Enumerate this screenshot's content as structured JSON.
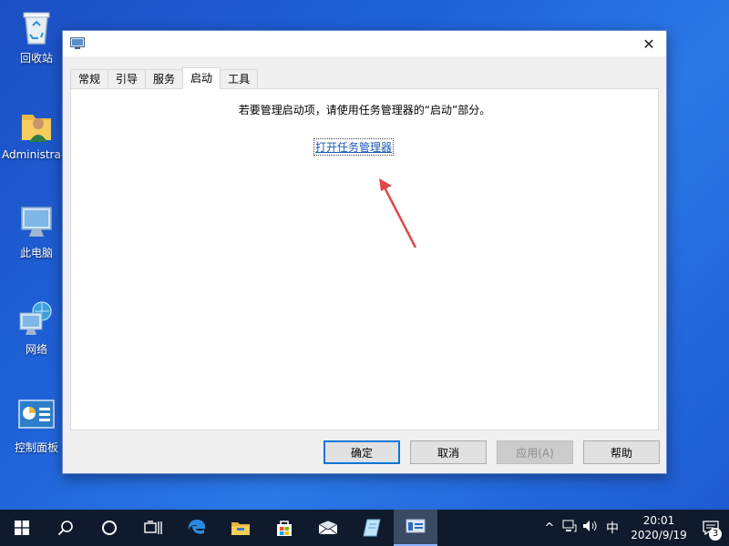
{
  "desktop": {
    "icons": [
      {
        "label": "回收站"
      },
      {
        "label": "Administra..."
      },
      {
        "label": "此电脑"
      },
      {
        "label": "网络"
      },
      {
        "label": "控制面板"
      }
    ]
  },
  "dialog": {
    "close_glyph": "✕",
    "tabs": [
      {
        "label": "常规"
      },
      {
        "label": "引导"
      },
      {
        "label": "服务"
      },
      {
        "label": "启动"
      },
      {
        "label": "工具"
      }
    ],
    "active_tab": "启动",
    "message": "若要管理启动项，请使用任务管理器的“启动”部分。",
    "link": "打开任务管理器",
    "buttons": {
      "ok": "确定",
      "cancel": "取消",
      "apply": "应用(A)",
      "help": "帮助"
    }
  },
  "taskbar": {
    "tray": {
      "chevron": "^",
      "ime": "中",
      "time": "20:01",
      "date": "2020/9/19",
      "notification_count": "3"
    }
  },
  "colors": {
    "accent": "#0078d7",
    "link": "#1a5ab8",
    "arrow": "#e0474c",
    "taskbar": "#0f1b2d"
  }
}
